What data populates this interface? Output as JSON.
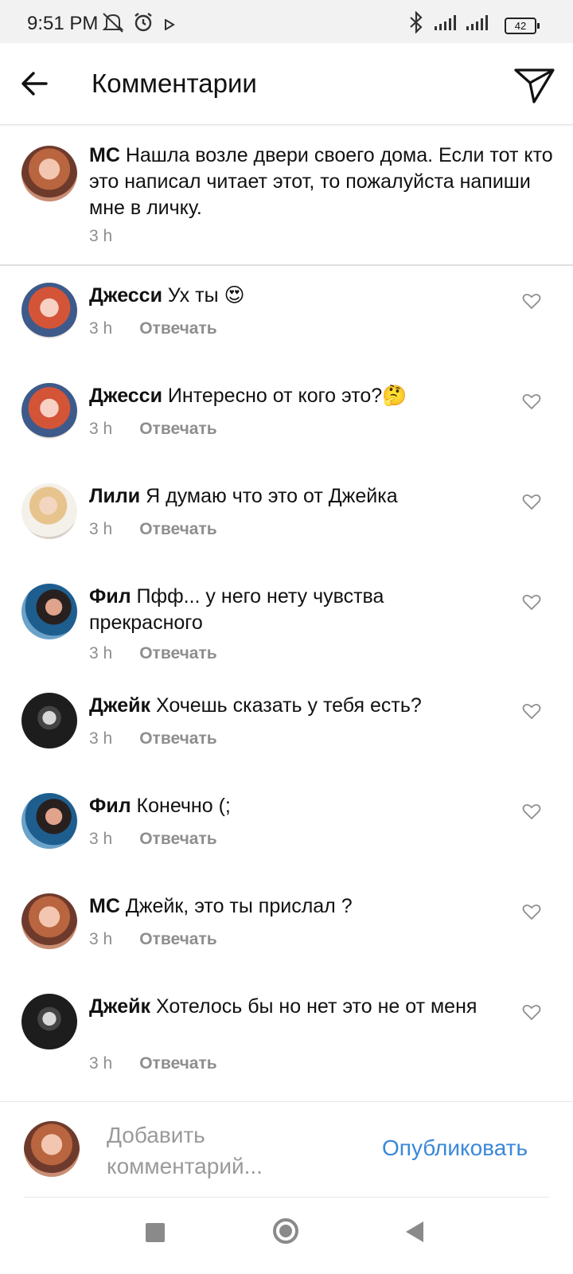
{
  "status_bar": {
    "time": "9:51 PM",
    "battery": "42"
  },
  "header": {
    "title": "Комментарии"
  },
  "caption": {
    "username": "МС",
    "text": "Нашла возле двери своего дома. Если тот кто это написал читает этот, то пожалуйста напиши мне в личку.",
    "time": "3 h"
  },
  "comments": [
    {
      "username": "Джесси",
      "text": "Ух ты 😍",
      "time": "3 h",
      "reply": "Отвечать"
    },
    {
      "username": "Джесси",
      "text": "Интересно от кого это?🤔",
      "time": "3 h",
      "reply": "Отвечать"
    },
    {
      "username": "Лили",
      "text": "Я думаю что это от Джейка",
      "time": "3 h",
      "reply": "Отвечать"
    },
    {
      "username": "Фил",
      "text": "Пфф... у него нету чувства прекрасного",
      "time": "3 h",
      "reply": "Отвечать"
    },
    {
      "username": "Джейк",
      "text": "Хочешь сказать у тебя есть?",
      "time": "3 h",
      "reply": "Отвечать"
    },
    {
      "username": "Фил",
      "text": "Конечно (;",
      "time": "3 h",
      "reply": "Отвечать"
    },
    {
      "username": "МС",
      "text": "Джейк, это ты прислал ?",
      "time": "3 h",
      "reply": "Отвечать"
    },
    {
      "username": "Джейк",
      "text": "Хотелось бы но нет это не от меня",
      "time": "3 h",
      "reply": "Отвечать"
    }
  ],
  "add_comment": {
    "placeholder": "Добавить комментарий...",
    "publish_label": "Опубликовать"
  },
  "colors": {
    "accent": "#3a88d8",
    "muted": "#8e8e8e"
  },
  "icons": [
    "back-arrow-icon",
    "send-icon",
    "heart-icon",
    "mute-icon",
    "alarm-icon",
    "bluetooth-icon",
    "signal-icon",
    "battery-icon"
  ]
}
